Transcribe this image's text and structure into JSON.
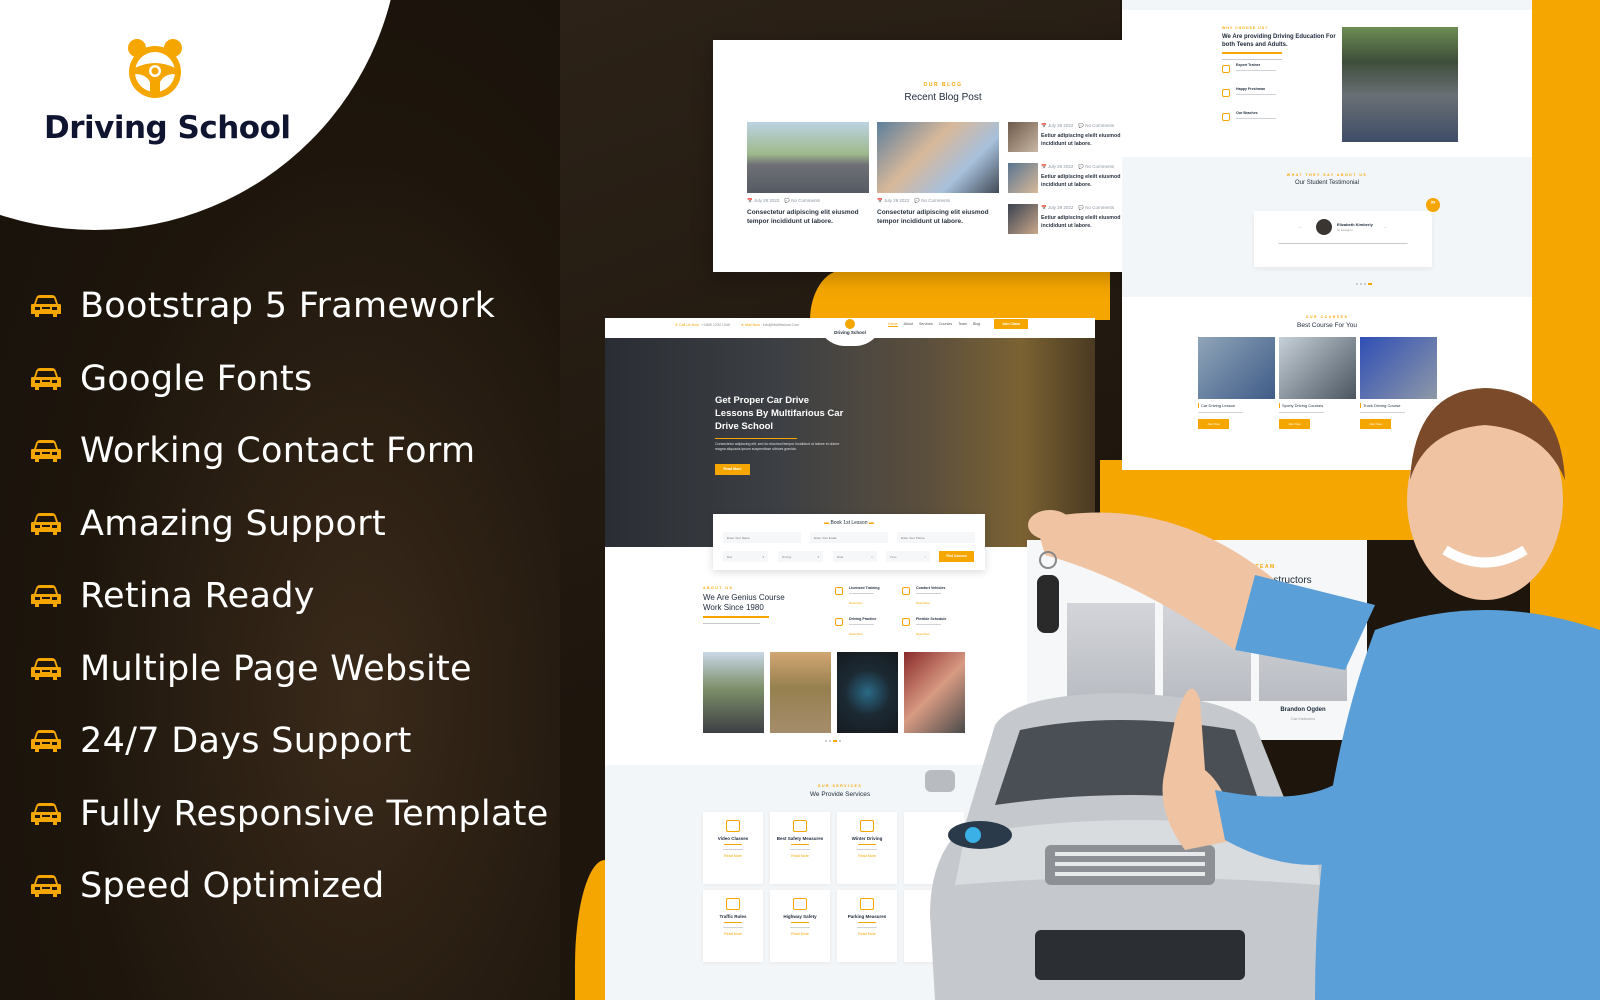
{
  "brand": {
    "name": "Driving School",
    "accent_color": "#f5a600",
    "dark_color": "#1e160d",
    "text_dark": "#0f1530"
  },
  "features": [
    {
      "icon": "car-icon",
      "label": "Bootstrap 5 Framework"
    },
    {
      "icon": "car-icon",
      "label": "Google Fonts"
    },
    {
      "icon": "car-icon",
      "label": "Working Contact Form"
    },
    {
      "icon": "car-icon",
      "label": "Amazing Support"
    },
    {
      "icon": "car-icon",
      "label": "Retina Ready"
    },
    {
      "icon": "car-icon",
      "label": "Multiple Page Website"
    },
    {
      "icon": "car-icon",
      "label": "24/7 Days Support"
    },
    {
      "icon": "car-icon",
      "label": "Fully Responsive Template"
    },
    {
      "icon": "car-icon",
      "label": "Speed Optimized"
    }
  ],
  "blog": {
    "subtitle": "OUR BLOG",
    "title": "Recent Blog Post",
    "big_posts": [
      {
        "date": "July 29 2022",
        "comments": "No Comments",
        "title": "Consectetur adipiscing elit eiusmod tempor incididunt ut labore."
      },
      {
        "date": "July 29 2022",
        "comments": "No Comments",
        "title": "Consectetur adipiscing elit eiusmod tempor incididunt ut labore."
      }
    ],
    "small_posts": [
      {
        "date": "July 29 2022",
        "comments": "No Comments",
        "title": "Eetiur adipiscing eleilt eiusmod tempor incididunt ut labore."
      },
      {
        "date": "July 29 2022",
        "comments": "No Comments",
        "title": "Eetiur adipiscing eleilt eiusmod tempor incididunt ut labore."
      },
      {
        "date": "July 29 2022",
        "comments": "No Comments",
        "title": "Eetiur adipiscing eleilt eiusmod tempor incididunt ut labore."
      }
    ]
  },
  "why": {
    "subtitle": "WHY CHOOSE US?",
    "title": "We Are providing Driving Education For both Teens and Adults.",
    "items": [
      {
        "icon": "trainer-icon",
        "title": "Expert Trainer"
      },
      {
        "icon": "freshman-icon",
        "title": "Happy Freshman"
      },
      {
        "icon": "branches-icon",
        "title": "Our Braches"
      }
    ]
  },
  "testimonial": {
    "subtitle": "WHAT THEY SAY ABOUT US",
    "title": "Our Student Testimonial",
    "name": "Elizabeth Kimberly",
    "role": "UI Designer",
    "prev": "←",
    "next": "→",
    "quote_icon": "”"
  },
  "courses": {
    "subtitle": "OUR COURSES",
    "title": "Best Course For You",
    "items": [
      {
        "title": "Car Driving Lesson",
        "button": "Join Now"
      },
      {
        "title": "Sporty Driving Courses",
        "button": "Join Now"
      },
      {
        "title": "Truck Driving Course",
        "button": "Join Now"
      }
    ]
  },
  "site_header": {
    "call_label": "Call Us Now :",
    "call_value": "+1800 1234 1345",
    "mail_label": "Mail Now :",
    "mail_value": "info@Multifarious.Com",
    "logo_text": "Driving School",
    "nav": [
      "Home",
      "About",
      "Services",
      "Courses",
      "Team",
      "Blog"
    ],
    "nav_active": "Home",
    "cta": "Join Class"
  },
  "hero": {
    "title": "Get Proper Car Drive Lessons By Multifarious Car Drive School",
    "text": "Consectetur adipiscing elit, sed do eiusmod tempor incididunt ut labore et dolore magna aliquauis ipsum suspendisse ultrices gravida.",
    "button": "Read More"
  },
  "booking": {
    "title": "Book 1st Lesson",
    "name_placeholder": "Enter Your Name",
    "email_placeholder": "Enter Your Email",
    "phone_placeholder": "Enter Your Phone",
    "select1": "Bus",
    "select2": "Driving",
    "date_placeholder": "Date",
    "time_placeholder": "Time",
    "button": "Find Courses"
  },
  "about": {
    "subtitle": "ABOUT US",
    "title": "We Are Genius Course Work Since 1980",
    "items": [
      {
        "title": "Licensed Training",
        "link": "Read More"
      },
      {
        "title": "Comfort Vehicles",
        "link": "Read More"
      },
      {
        "title": "Driving Practice",
        "link": "Read More"
      },
      {
        "title": "Flexible Schedule",
        "link": "Read More"
      }
    ]
  },
  "services": {
    "subtitle": "OUR SERVICES",
    "title": "We Provide Services",
    "items": [
      {
        "title": "Video Classes",
        "link": "Read More"
      },
      {
        "title": "Best Safety Measures",
        "link": "Read More"
      },
      {
        "title": "Winter Driving",
        "link": "Read More"
      },
      {
        "title": "Traffic Rules",
        "link": "Read More"
      },
      {
        "title": "Highway Safety",
        "link": "Read More"
      },
      {
        "title": "Parking Measures",
        "link": "Read More"
      }
    ]
  },
  "team": {
    "subtitle": "OUR TEAM",
    "title": "Instructors",
    "member_name": "Brandon Ogden",
    "member_role": "Car Instructor"
  }
}
